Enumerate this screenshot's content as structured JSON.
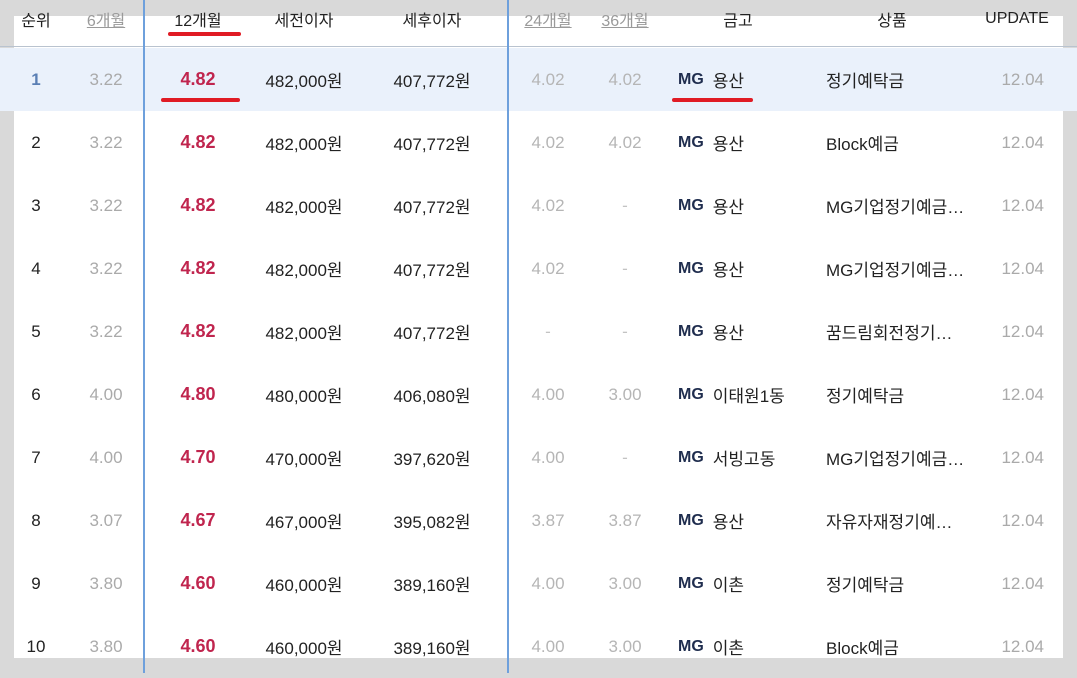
{
  "header": {
    "rank": "순위",
    "m6": "6개월",
    "m12": "12개월",
    "pretax": "세전이자",
    "aftertax": "세후이자",
    "m24": "24개월",
    "m36": "36개월",
    "bank": "금고",
    "product": "상품",
    "update": "UPDATE"
  },
  "rows": [
    {
      "rank": "1",
      "m6": "3.22",
      "m12": "4.82",
      "pretax": "482,000원",
      "aftertax": "407,772원",
      "m24": "4.02",
      "m36": "4.02",
      "bank_prefix": "MG",
      "bank": "용산",
      "product": "정기예탁금",
      "update": "12.04"
    },
    {
      "rank": "2",
      "m6": "3.22",
      "m12": "4.82",
      "pretax": "482,000원",
      "aftertax": "407,772원",
      "m24": "4.02",
      "m36": "4.02",
      "bank_prefix": "MG",
      "bank": "용산",
      "product": "Block예금",
      "update": "12.04"
    },
    {
      "rank": "3",
      "m6": "3.22",
      "m12": "4.82",
      "pretax": "482,000원",
      "aftertax": "407,772원",
      "m24": "4.02",
      "m36": "-",
      "bank_prefix": "MG",
      "bank": "용산",
      "product": "MG기업정기예금…",
      "update": "12.04"
    },
    {
      "rank": "4",
      "m6": "3.22",
      "m12": "4.82",
      "pretax": "482,000원",
      "aftertax": "407,772원",
      "m24": "4.02",
      "m36": "-",
      "bank_prefix": "MG",
      "bank": "용산",
      "product": "MG기업정기예금…",
      "update": "12.04"
    },
    {
      "rank": "5",
      "m6": "3.22",
      "m12": "4.82",
      "pretax": "482,000원",
      "aftertax": "407,772원",
      "m24": "-",
      "m36": "-",
      "bank_prefix": "MG",
      "bank": "용산",
      "product": "꿈드림회전정기…",
      "update": "12.04"
    },
    {
      "rank": "6",
      "m6": "4.00",
      "m12": "4.80",
      "pretax": "480,000원",
      "aftertax": "406,080원",
      "m24": "4.00",
      "m36": "3.00",
      "bank_prefix": "MG",
      "bank": "이태원1동",
      "product": "정기예탁금",
      "update": "12.04"
    },
    {
      "rank": "7",
      "m6": "4.00",
      "m12": "4.70",
      "pretax": "470,000원",
      "aftertax": "397,620원",
      "m24": "4.00",
      "m36": "-",
      "bank_prefix": "MG",
      "bank": "서빙고동",
      "product": "MG기업정기예금…",
      "update": "12.04"
    },
    {
      "rank": "8",
      "m6": "3.07",
      "m12": "4.67",
      "pretax": "467,000원",
      "aftertax": "395,082원",
      "m24": "3.87",
      "m36": "3.87",
      "bank_prefix": "MG",
      "bank": "용산",
      "product": "자유자재정기예…",
      "update": "12.04"
    },
    {
      "rank": "9",
      "m6": "3.80",
      "m12": "4.60",
      "pretax": "460,000원",
      "aftertax": "389,160원",
      "m24": "4.00",
      "m36": "3.00",
      "bank_prefix": "MG",
      "bank": "이촌",
      "product": "정기예탁금",
      "update": "12.04"
    },
    {
      "rank": "10",
      "m6": "3.80",
      "m12": "4.60",
      "pretax": "460,000원",
      "aftertax": "389,160원",
      "m24": "4.00",
      "m36": "3.00",
      "bank_prefix": "MG",
      "bank": "이촌",
      "product": "Block예금",
      "update": "12.04"
    }
  ]
}
